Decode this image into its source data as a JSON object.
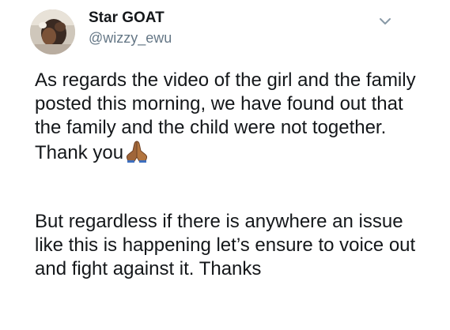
{
  "user": {
    "display_name": "Star GOAT",
    "handle": "@wizzy_ewu",
    "avatar_icon": "profile-avatar"
  },
  "header": {
    "menu_icon": "chevron-down-icon"
  },
  "tweet": {
    "paragraph_1": "As regards the video of the girl and the family posted this morning, we have found out that the family and the child were not together. Thank you",
    "emoji_icon": "folded-hands-emoji",
    "paragraph_2": "But regardless if there is anywhere an issue like this is happening let’s ensure to voice out and fight against it. Thanks"
  },
  "colors": {
    "text": "#14171a",
    "secondary_text": "#657786",
    "chevron": "#8899a6",
    "emoji_skin": "#a0663a"
  }
}
